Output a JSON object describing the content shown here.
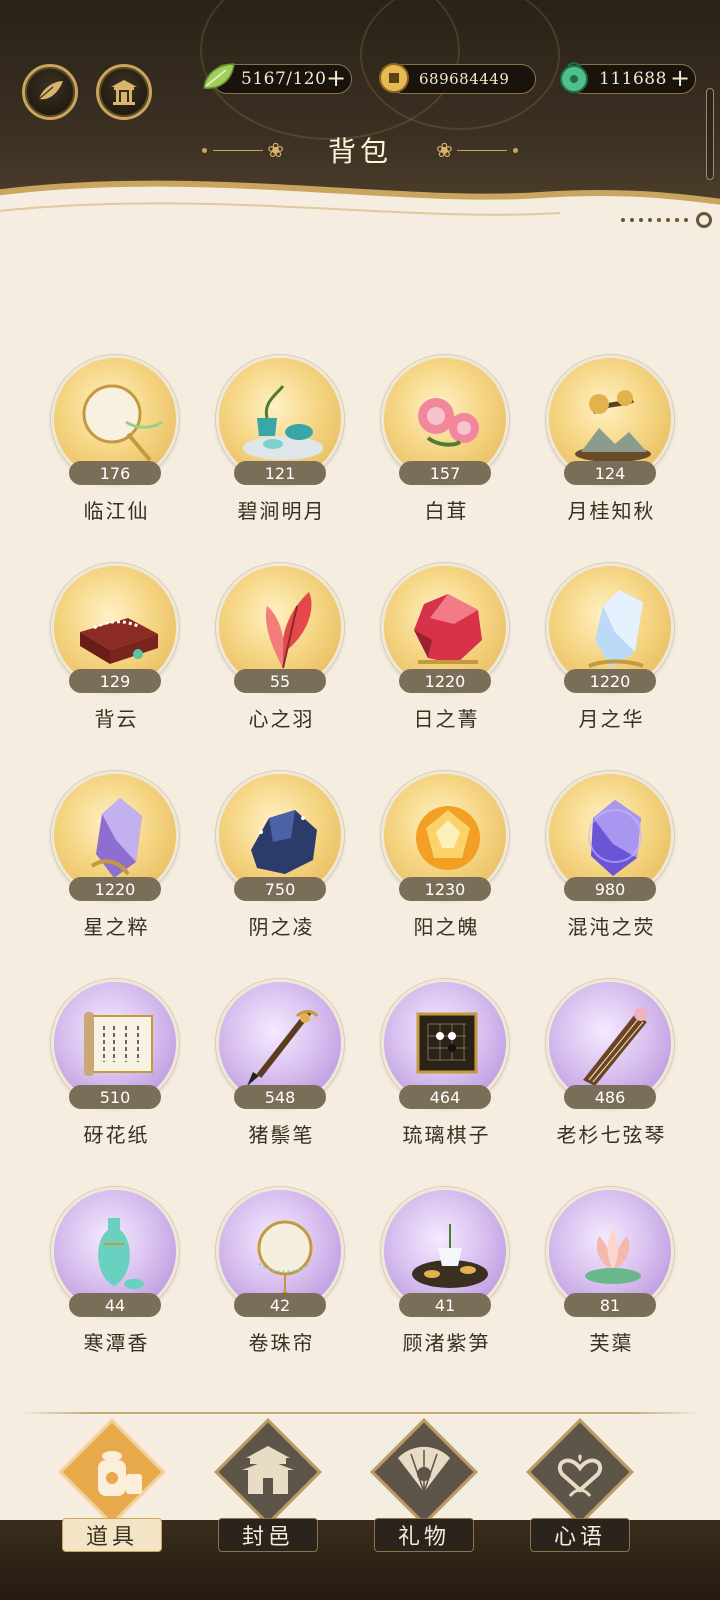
{
  "header": {
    "title": "背包",
    "resources": [
      {
        "icon": "leaf-stamina-icon",
        "value": "5167/120",
        "has_plus": true
      },
      {
        "icon": "copper-coin-icon",
        "value": "689684449",
        "has_plus": false
      },
      {
        "icon": "jade-currency-icon",
        "value": "111688",
        "has_plus": true
      }
    ],
    "plus_glyph": "+",
    "title_ornament": "❀"
  },
  "items": [
    {
      "name": "临江仙",
      "count": "176",
      "tier": "gold",
      "icon": "round-fan-icon"
    },
    {
      "name": "碧涧明月",
      "count": "121",
      "tier": "gold",
      "icon": "tea-set-icon"
    },
    {
      "name": "白茸",
      "count": "157",
      "tier": "gold",
      "icon": "peony-flower-icon"
    },
    {
      "name": "月桂知秋",
      "count": "124",
      "tier": "gold",
      "icon": "bonsai-incense-icon"
    },
    {
      "name": "背云",
      "count": "129",
      "tier": "gold",
      "icon": "jewelry-box-icon"
    },
    {
      "name": "心之羽",
      "count": "55",
      "tier": "gold",
      "icon": "red-feather-icon"
    },
    {
      "name": "日之菁",
      "count": "1220",
      "tier": "gold",
      "icon": "red-gem-icon"
    },
    {
      "name": "月之华",
      "count": "1220",
      "tier": "gold",
      "icon": "ice-crystal-icon"
    },
    {
      "name": "星之粹",
      "count": "1220",
      "tier": "gold",
      "icon": "purple-crystal-icon"
    },
    {
      "name": "阴之凌",
      "count": "750",
      "tier": "gold",
      "icon": "dark-ore-icon"
    },
    {
      "name": "阳之魄",
      "count": "1230",
      "tier": "gold",
      "icon": "amber-gem-icon"
    },
    {
      "name": "混沌之荧",
      "count": "980",
      "tier": "gold",
      "icon": "chaos-crystal-icon"
    },
    {
      "name": "砑花纸",
      "count": "510",
      "tier": "purple",
      "icon": "scroll-paper-icon"
    },
    {
      "name": "猪鬃笔",
      "count": "548",
      "tier": "purple",
      "icon": "brush-pen-icon"
    },
    {
      "name": "琉璃棋子",
      "count": "464",
      "tier": "purple",
      "icon": "go-board-icon"
    },
    {
      "name": "老杉七弦琴",
      "count": "486",
      "tier": "purple",
      "icon": "guqin-icon"
    },
    {
      "name": "寒潭香",
      "count": "44",
      "tier": "purple",
      "icon": "wine-vase-icon"
    },
    {
      "name": "卷珠帘",
      "count": "42",
      "tier": "purple",
      "icon": "bead-curtain-icon"
    },
    {
      "name": "顾渚紫笋",
      "count": "41",
      "tier": "purple",
      "icon": "tea-tray-icon"
    },
    {
      "name": "芙蕖",
      "count": "81",
      "tier": "purple",
      "icon": "lotus-icon"
    }
  ],
  "nav": [
    {
      "label": "道具",
      "icon": "items-jar-icon",
      "active": true
    },
    {
      "label": "封邑",
      "icon": "palace-icon",
      "active": false
    },
    {
      "label": "礼物",
      "icon": "folding-fan-icon",
      "active": false
    },
    {
      "label": "心语",
      "icon": "heart-flower-icon",
      "active": false
    }
  ],
  "colors": {
    "header_bg": "#2a2217",
    "gold_accent": "#c9a55f",
    "page_bg": "#f4ede0",
    "count_badge": "#7b6e58",
    "name_text": "#3b2f21",
    "active_tab": "#e8a84e"
  }
}
